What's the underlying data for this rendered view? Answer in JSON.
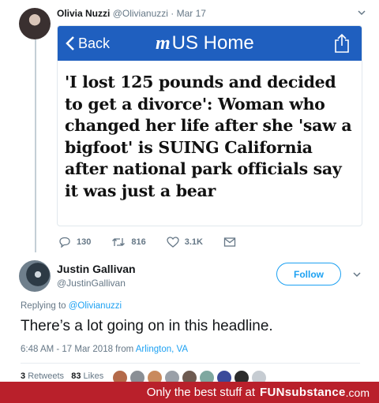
{
  "quoted_tweet": {
    "author_name": "Olivia Nuzzi",
    "author_handle": "@Olivianuzzi",
    "date": "· Mar 17",
    "card": {
      "back_label": "Back",
      "logo_text": "m",
      "home_label": "US Home",
      "headline": "'I lost 125 pounds and decided to get a divorce': Woman who changed her life after she 'saw a bigfoot' is SUING California after national park officials say it was just a bear"
    },
    "actions": {
      "replies": "130",
      "retweets": "816",
      "likes": "3.1K"
    }
  },
  "main_tweet": {
    "author_name": "Justin Gallivan",
    "author_handle": "@JustinGallivan",
    "follow_label": "Follow",
    "replying_prefix": "Replying to",
    "replying_to": "@Olivianuzzi",
    "text": "There’s a lot going on in this headline.",
    "timestamp": "6:48 AM - 17 Mar 2018 from",
    "location": "Arlington, VA",
    "retweets_count": "3",
    "retweets_label": "Retweets",
    "likes_count": "83",
    "likes_label": "Likes"
  },
  "watermark": {
    "prefix": "Only the best stuff at",
    "brand": "FUNsubstance",
    "suffix": ".com"
  },
  "colors": {
    "twitter_blue": "#1da1f2",
    "card_bar": "#1f5fbf",
    "banner": "#b9202b",
    "secondary_text": "#657786"
  },
  "icons": [
    "chevron-down-icon",
    "back-chevron-icon",
    "share-icon",
    "reply-icon",
    "retweet-icon",
    "like-icon",
    "dm-icon"
  ]
}
